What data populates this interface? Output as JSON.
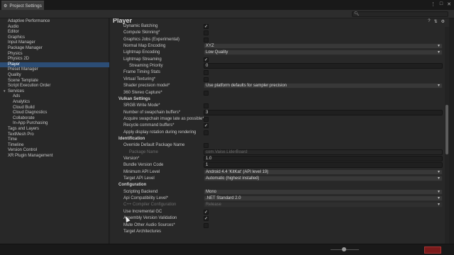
{
  "window": {
    "title": "Project Settings",
    "controls": [
      "⋮",
      "□",
      "✕"
    ]
  },
  "search": {
    "placeholder": "",
    "icon": "search-icon"
  },
  "sidebar": {
    "items": [
      {
        "label": "Adaptive Performance",
        "sub": false
      },
      {
        "label": "Audio",
        "sub": false
      },
      {
        "label": "Editor",
        "sub": false
      },
      {
        "label": "Graphics",
        "sub": false
      },
      {
        "label": "Input Manager",
        "sub": false
      },
      {
        "label": "Package Manager",
        "sub": false
      },
      {
        "label": "Physics",
        "sub": false
      },
      {
        "label": "Physics 2D",
        "sub": false
      },
      {
        "label": "Player",
        "sub": false,
        "selected": true
      },
      {
        "label": "Preset Manager",
        "sub": false
      },
      {
        "label": "Quality",
        "sub": false
      },
      {
        "label": "Scene Template",
        "sub": false
      },
      {
        "label": "Script Execution Order",
        "sub": false
      },
      {
        "label": "Services",
        "sub": false,
        "expandable": true
      },
      {
        "label": "Ads",
        "sub": true
      },
      {
        "label": "Analytics",
        "sub": true
      },
      {
        "label": "Cloud Build",
        "sub": true
      },
      {
        "label": "Cloud Diagnostics",
        "sub": true
      },
      {
        "label": "Collaborate",
        "sub": true
      },
      {
        "label": "In-App Purchasing",
        "sub": true
      },
      {
        "label": "Tags and Layers",
        "sub": false
      },
      {
        "label": "TextMesh Pro",
        "sub": false
      },
      {
        "label": "Time",
        "sub": false
      },
      {
        "label": "Timeline",
        "sub": false
      },
      {
        "label": "Version Control",
        "sub": false
      },
      {
        "label": "XR Plugin Management",
        "sub": false
      }
    ]
  },
  "main": {
    "title": "Player",
    "header_icons": [
      "help-icon",
      "preset-icon",
      "settings-icon"
    ],
    "rows": [
      {
        "kind": "check",
        "label": "Dynamic Batching",
        "checked": true
      },
      {
        "kind": "check",
        "label": "Compute Skinning*",
        "checked": false
      },
      {
        "kind": "check",
        "label": "Graphics Jobs (Experimental)",
        "checked": false
      },
      {
        "kind": "dropdown",
        "label": "Normal Map Encoding",
        "value": "XYZ"
      },
      {
        "kind": "dropdown",
        "label": "Lightmap Encoding",
        "value": "Low Quality"
      },
      {
        "kind": "check",
        "label": "Lightmap Streaming",
        "checked": true
      },
      {
        "kind": "text",
        "label": "Streaming Priority",
        "value": "0",
        "indent": true
      },
      {
        "kind": "check",
        "label": "Frame Timing Stats",
        "checked": false
      },
      {
        "kind": "check",
        "label": "Virtual Texturing*",
        "checked": false
      },
      {
        "kind": "dropdown",
        "label": "Shader precision model*",
        "value": "Use platform defaults for sampler precision"
      },
      {
        "kind": "check",
        "label": "360 Stereo Capture*",
        "checked": false
      },
      {
        "kind": "section",
        "label": "Vulkan Settings"
      },
      {
        "kind": "check",
        "label": "SRGB Write Mode*",
        "checked": false
      },
      {
        "kind": "text",
        "label": "Number of swapchain buffers*",
        "value": "3"
      },
      {
        "kind": "check",
        "label": "Acquire swapchain image late as possible*",
        "checked": false
      },
      {
        "kind": "check",
        "label": "Recycle command buffers*",
        "checked": true
      },
      {
        "kind": "check",
        "label": "Apply display rotation during rendering",
        "checked": false
      },
      {
        "kind": "section",
        "label": "Identification"
      },
      {
        "kind": "check",
        "label": "Override Default Package Name",
        "checked": false
      },
      {
        "kind": "text",
        "label": "Package Name",
        "value": "com.Vaise.LiderBoard",
        "indent": true,
        "dim": true
      },
      {
        "kind": "text",
        "label": "Version*",
        "value": "1.0"
      },
      {
        "kind": "text",
        "label": "Bundle Version Code",
        "value": "1"
      },
      {
        "kind": "dropdown",
        "label": "Minimum API Level",
        "value": "Android 4.4 'KitKat' (API level 19)"
      },
      {
        "kind": "dropdown",
        "label": "Target API Level",
        "value": "Automatic (highest installed)"
      },
      {
        "kind": "section",
        "label": "Configuration"
      },
      {
        "kind": "dropdown",
        "label": "Scripting Backend",
        "value": "Mono"
      },
      {
        "kind": "dropdown",
        "label": "Api Compatibility Level*",
        "value": ".NET Standard 2.0"
      },
      {
        "kind": "dropdown",
        "label": "C++ Compiler Configuration",
        "value": "Release",
        "dim": true
      },
      {
        "kind": "check",
        "label": "Use Incremental GC",
        "checked": true
      },
      {
        "kind": "check",
        "label": "Assembly Version Validation",
        "checked": true
      },
      {
        "kind": "check",
        "label": "Mute Other Audio Sources*",
        "checked": false
      },
      {
        "kind": "label",
        "label": "Target Architectures"
      }
    ]
  },
  "statusbar": {
    "badge": ""
  },
  "colors": {
    "selection": "#2c4d75",
    "panel": "#282828",
    "field": "#1f1f1f"
  }
}
